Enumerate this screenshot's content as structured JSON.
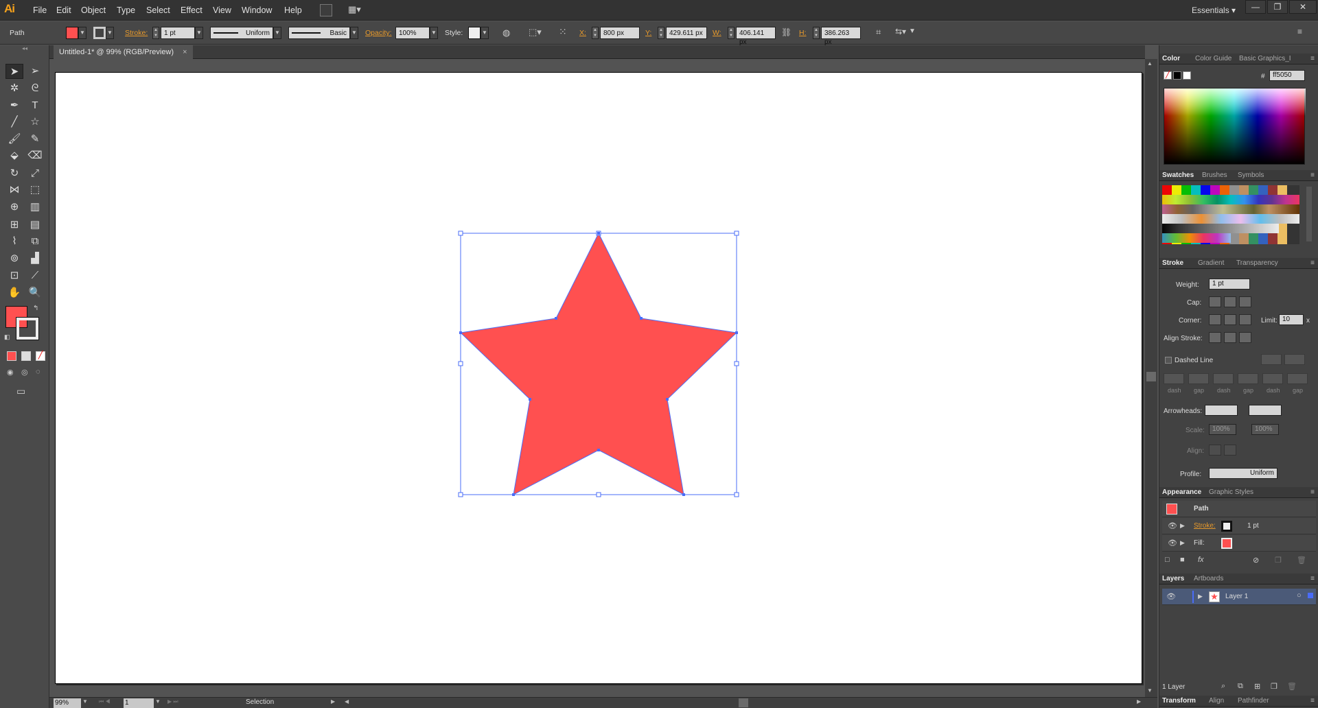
{
  "app": {
    "logo": "Ai"
  },
  "menu": [
    "File",
    "Edit",
    "Object",
    "Type",
    "Select",
    "Effect",
    "View",
    "Window",
    "Help"
  ],
  "workspace": "Essentials",
  "window_controls": {
    "minimize": "—",
    "maximize": "❐",
    "close": "✕"
  },
  "control_bar": {
    "selection_type": "Path",
    "stroke_label": "Stroke:",
    "stroke_weight": "1 pt",
    "profile": "Uniform",
    "brush": "Basic",
    "opacity_label": "Opacity:",
    "opacity": "100%",
    "style_label": "Style:",
    "x_label": "X:",
    "x": "800 px",
    "y_label": "Y:",
    "y": "429.611 px",
    "w_label": "W:",
    "w": "406.141 px",
    "h_label": "H:",
    "h": "386.263 px"
  },
  "document_tab": {
    "title": "Untitled-1* @ 99% (RGB/Preview)",
    "close": "×"
  },
  "status_bar": {
    "zoom": "99%",
    "artboard_number": "1",
    "tool": "Selection"
  },
  "colors": {
    "fill": "#ff5050",
    "star_fill": "#ff5050",
    "selection": "#4a6cf7"
  },
  "panels": {
    "color": {
      "tabs": [
        "Color",
        "Color Guide",
        "Basic Graphics_I"
      ],
      "hex": "ff5050",
      "hash": "#"
    },
    "swatches": {
      "tabs": [
        "Swatches",
        "Brushes",
        "Symbols"
      ]
    },
    "stroke": {
      "tabs": [
        "Stroke",
        "Gradient",
        "Transparency"
      ],
      "weight_label": "Weight:",
      "weight": "1 pt",
      "cap_label": "Cap:",
      "corner_label": "Corner:",
      "limit_label": "Limit:",
      "limit": "10",
      "limit_unit": "x",
      "align_label": "Align Stroke:",
      "dashed_label": "Dashed Line",
      "dash_labels": [
        "dash",
        "gap",
        "dash",
        "gap",
        "dash",
        "gap"
      ],
      "arrowheads_label": "Arrowheads:",
      "scale_label": "Scale:",
      "scale1": "100%",
      "scale2": "100%",
      "align2_label": "Align:",
      "profile_label": "Profile:",
      "profile": "Uniform"
    },
    "appearance": {
      "tabs": [
        "Appearance",
        "Graphic Styles"
      ],
      "object": "Path",
      "stroke_label": "Stroke:",
      "stroke_value": "1 pt",
      "fill_label": "Fill:"
    },
    "layers": {
      "tabs": [
        "Layers",
        "Artboards"
      ],
      "layer_name": "Layer 1",
      "count": "1 Layer"
    },
    "bottom": {
      "tabs": [
        "Transform",
        "Align",
        "Pathfinder"
      ]
    }
  }
}
